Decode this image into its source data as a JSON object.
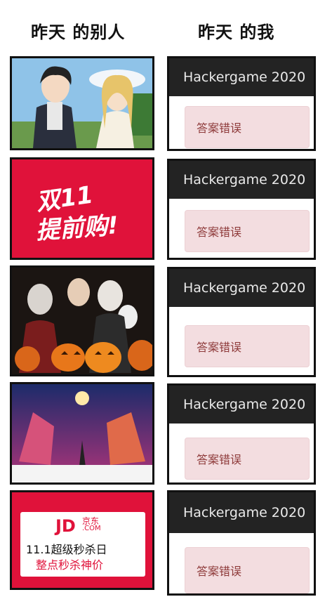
{
  "header": {
    "left_title": "昨天 的别人",
    "right_title": "昨天 的我"
  },
  "panels": [
    {
      "image": "anime-characters-scene",
      "card_title": "Hackergame 2020",
      "alert_text": "答案错误"
    },
    {
      "image": "double-eleven-banner",
      "banner_line1": "双11",
      "banner_line2": "提前购!",
      "card_title": "Hackergame 2020",
      "alert_text": "答案错误"
    },
    {
      "image": "halloween-pumpkins-photo",
      "card_title": "Hackergame 2020",
      "alert_text": "答案错误"
    },
    {
      "image": "concert-stage-poster",
      "card_title": "Hackergame 2020",
      "alert_text": "答案错误"
    },
    {
      "image": "jd-sale-banner",
      "jd_logo": "JD",
      "jd_sub": "京东",
      "jd_com": ".COM",
      "jd_line1": "11.1超级秒杀日",
      "jd_line2": "整点秒杀神价",
      "card_title": "Hackergame 2020",
      "alert_text": "答案错误"
    }
  ],
  "colors": {
    "card_header": "#232323",
    "alert_bg": "#f3dde0",
    "alert_text": "#8e3a3a",
    "sale_red": "#e0123a"
  }
}
